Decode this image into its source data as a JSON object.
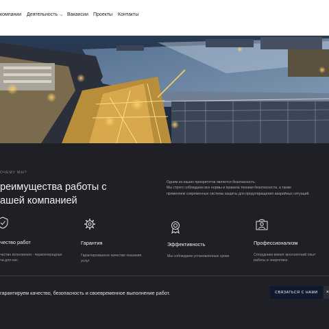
{
  "nav": {
    "items": [
      {
        "label": "компании"
      },
      {
        "label": "Деятельность"
      },
      {
        "label": "Вакансии"
      },
      {
        "label": "Проекты"
      },
      {
        "label": "Контакты"
      }
    ]
  },
  "section": {
    "eyebrow": "ОЧЕМУ МЫ?",
    "headline_line1": "реимущества работы с",
    "headline_line2": "ашей компанией",
    "intro_line1": "Одним из наших приоритетов является безопасность.",
    "intro_line2": "Мы строго соблюдаем все нормы и правила техники безопасности, а также",
    "intro_line3": "применяем современные системы защиты для предотвращения аварийных ситуаций."
  },
  "features": [
    {
      "icon": "shield-icon",
      "title": "чество работ",
      "text_line1": "чество исполнения - первоочередная",
      "text_line2": "ча для нас."
    },
    {
      "icon": "gear-icon",
      "title": "Гарантия",
      "text_line1": "Гарантированное качество оказания",
      "text_line2": "услуг"
    },
    {
      "icon": "medal-icon",
      "title": "Эффективность",
      "text_line1": "Мы соблюдаем установленные сроки",
      "text_line2": ""
    },
    {
      "icon": "worker-icon",
      "title": "Профессионализм",
      "text_line1": "Сотрудники имеют многолетний опыт",
      "text_line2": "работы в энергетике."
    }
  ],
  "footer_cta": {
    "text": "гарантируем качество, безопасность и своевременное выполнение работ.",
    "button_label": "СВЯЗАТЬСЯ С НАМИ",
    "close_label": "×"
  },
  "colors": {
    "background": "#1f2025",
    "button": "#0f1a2e",
    "heading": "#f2f2f2",
    "muted": "#a9acb4"
  }
}
